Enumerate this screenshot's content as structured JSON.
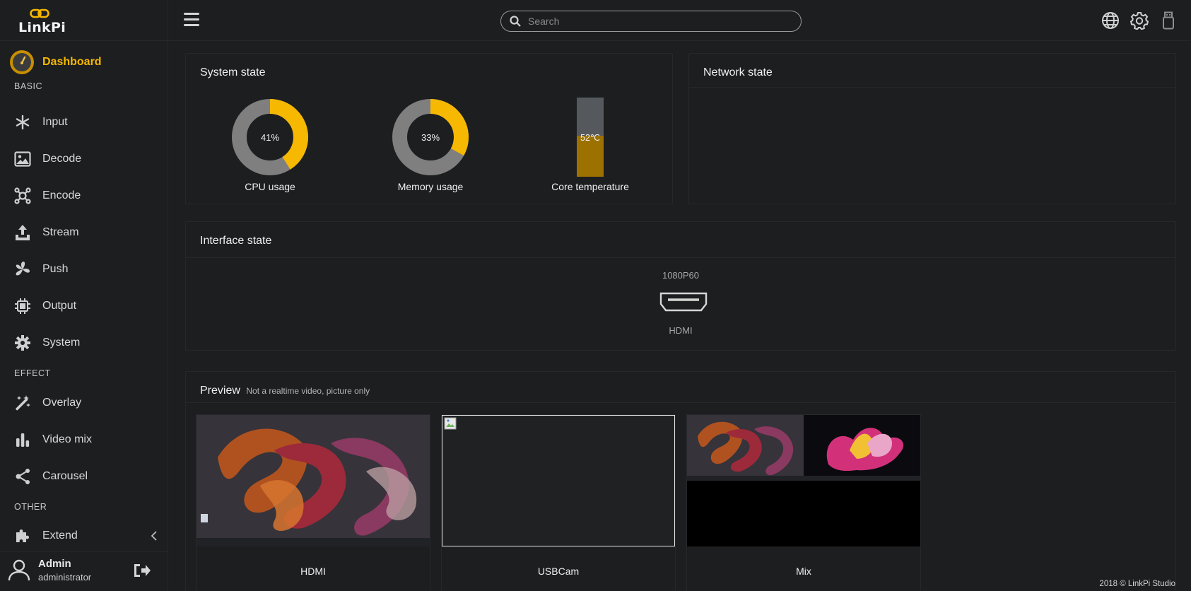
{
  "brand": {
    "name": "LinkPi",
    "accent": "#f5b800"
  },
  "sidebar": {
    "dashboard_label": "Dashboard",
    "sections": {
      "basic": "BASIC",
      "effect": "EFFECT",
      "other": "OTHER"
    },
    "items": [
      {
        "label": "Input",
        "icon": "asterisk-icon"
      },
      {
        "label": "Decode",
        "icon": "image-icon"
      },
      {
        "label": "Encode",
        "icon": "encode-icon"
      },
      {
        "label": "Stream",
        "icon": "upload-icon"
      },
      {
        "label": "Push",
        "icon": "fan-icon"
      },
      {
        "label": "Output",
        "icon": "chip-icon"
      },
      {
        "label": "System",
        "icon": "gear-icon"
      },
      {
        "label": "Overlay",
        "icon": "magic-wand-icon"
      },
      {
        "label": "Video mix",
        "icon": "bars-icon"
      },
      {
        "label": "Carousel",
        "icon": "carousel-icon"
      },
      {
        "label": "Extend",
        "icon": "puzzle-icon"
      }
    ],
    "user": {
      "name": "Admin",
      "role": "administrator"
    }
  },
  "topbar": {
    "search_placeholder": "Search"
  },
  "system_state": {
    "title": "System state",
    "cpu": {
      "label": "CPU usage",
      "value": "41%",
      "fraction": 0.41
    },
    "memory": {
      "label": "Memory usage",
      "value": "33%",
      "fraction": 0.33
    },
    "temperature": {
      "label": "Core temperature",
      "value": "52℃",
      "fraction": 0.52
    }
  },
  "network_state": {
    "title": "Network state"
  },
  "interface_state": {
    "title": "Interface state",
    "resolution": "1080P60",
    "name": "HDMI"
  },
  "preview": {
    "title": "Preview",
    "subtitle": "Not a realtime video, picture only",
    "items": [
      {
        "label": "HDMI"
      },
      {
        "label": "USBCam"
      },
      {
        "label": "Mix"
      }
    ]
  },
  "footer": "2018 © LinkPi Studio"
}
